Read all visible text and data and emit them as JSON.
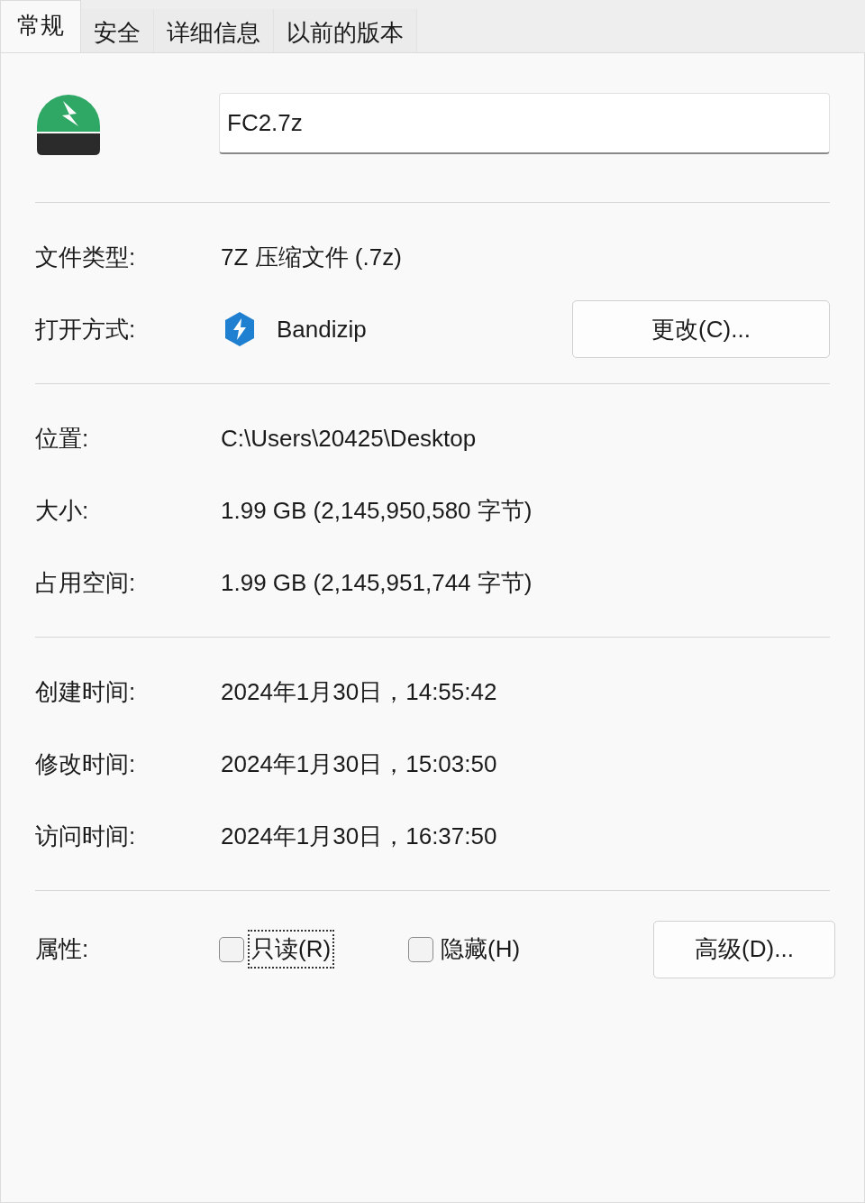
{
  "tabs": [
    {
      "label": "常规",
      "selected": true
    },
    {
      "label": "安全",
      "selected": false
    },
    {
      "label": "详细信息",
      "selected": false
    },
    {
      "label": "以前的版本",
      "selected": false
    }
  ],
  "file": {
    "name": "FC2.7z"
  },
  "sections": [
    {
      "rows": [
        {
          "kind": "text",
          "label": "文件类型:",
          "value": "7Z 压缩文件 (.7z)"
        },
        {
          "kind": "app",
          "label": "打开方式:",
          "value": "Bandizip",
          "button": "更改(C)..."
        }
      ]
    },
    {
      "rows": [
        {
          "kind": "text",
          "label": "位置:",
          "value": "C:\\Users\\20425\\Desktop"
        },
        {
          "kind": "text",
          "label": "大小:",
          "value": "1.99 GB (2,145,950,580 字节)"
        },
        {
          "kind": "text",
          "label": "占用空间:",
          "value": "1.99 GB (2,145,951,744 字节)"
        }
      ]
    },
    {
      "rows": [
        {
          "kind": "text",
          "label": "创建时间:",
          "value": "2024年1月30日，14:55:42"
        },
        {
          "kind": "text",
          "label": "修改时间:",
          "value": "2024年1月30日，15:03:50"
        },
        {
          "kind": "text",
          "label": "访问时间:",
          "value": "2024年1月30日，16:37:50"
        }
      ]
    }
  ],
  "attributes": {
    "label": "属性:",
    "checkboxes": [
      {
        "label": "只读(R)",
        "checked": false,
        "focused": true
      },
      {
        "label": "隐藏(H)",
        "checked": false,
        "focused": false
      }
    ],
    "button": "高级(D)..."
  }
}
